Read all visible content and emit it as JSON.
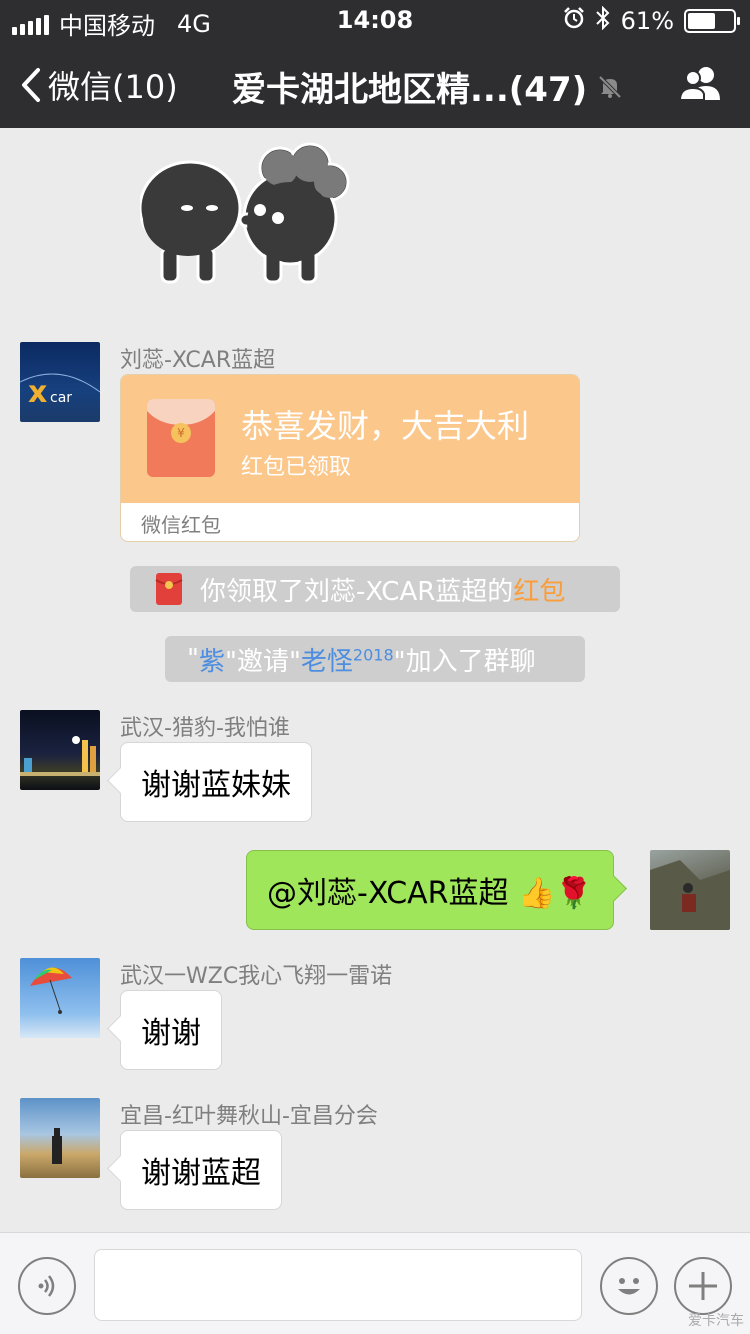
{
  "status_bar": {
    "carrier": "中国移动",
    "network": "4G",
    "time": "14:08",
    "battery": "61%",
    "battery_level": 0.61
  },
  "nav": {
    "back_label": "微信(10)",
    "title": "爱卡湖北地区精...(47)"
  },
  "messages": {
    "redpacket": {
      "sender": "刘蕊-XCAR蓝超",
      "wish": "恭喜发财，大吉大利",
      "status": "红包已领取",
      "footer": "微信红包",
      "coin_symbol": "¥"
    },
    "sys_redpacket": {
      "prefix": "你领取了刘蕊-XCAR蓝超的",
      "highlight": "红包"
    },
    "sys_invite": {
      "q1": "\"",
      "inviter": "紫",
      "mid": "\"邀请\"",
      "invitee": "老怪",
      "invitee_sup": "2018",
      "tail": "\"加入了群聊"
    },
    "msg1": {
      "sender": "武汉-猎豹-我怕谁",
      "text": "谢谢蓝妹妹"
    },
    "msg2": {
      "text": "@刘蕊-XCAR蓝超 👍🌹"
    },
    "msg3": {
      "sender": "武汉一WZC我心飞翔一雷诺",
      "text": "谢谢"
    },
    "msg4": {
      "sender": "宜昌-红叶舞秋山-宜昌分会",
      "text": "谢谢蓝超"
    }
  },
  "colors": {
    "nav_bg": "#2e2e30",
    "chat_bg": "#ebebeb",
    "mine_bubble": "#9fe65a",
    "redpacket": "#fbc78b",
    "link_orange": "#fa9d3b",
    "link_blue": "#4d8ee0"
  },
  "icons": [
    "back-chevron-icon",
    "mute-bell-icon",
    "group-members-icon",
    "voice-icon",
    "emoji-icon",
    "plus-icon",
    "alarm-icon",
    "bluetooth-icon"
  ],
  "watermark": "爱卡汽车"
}
